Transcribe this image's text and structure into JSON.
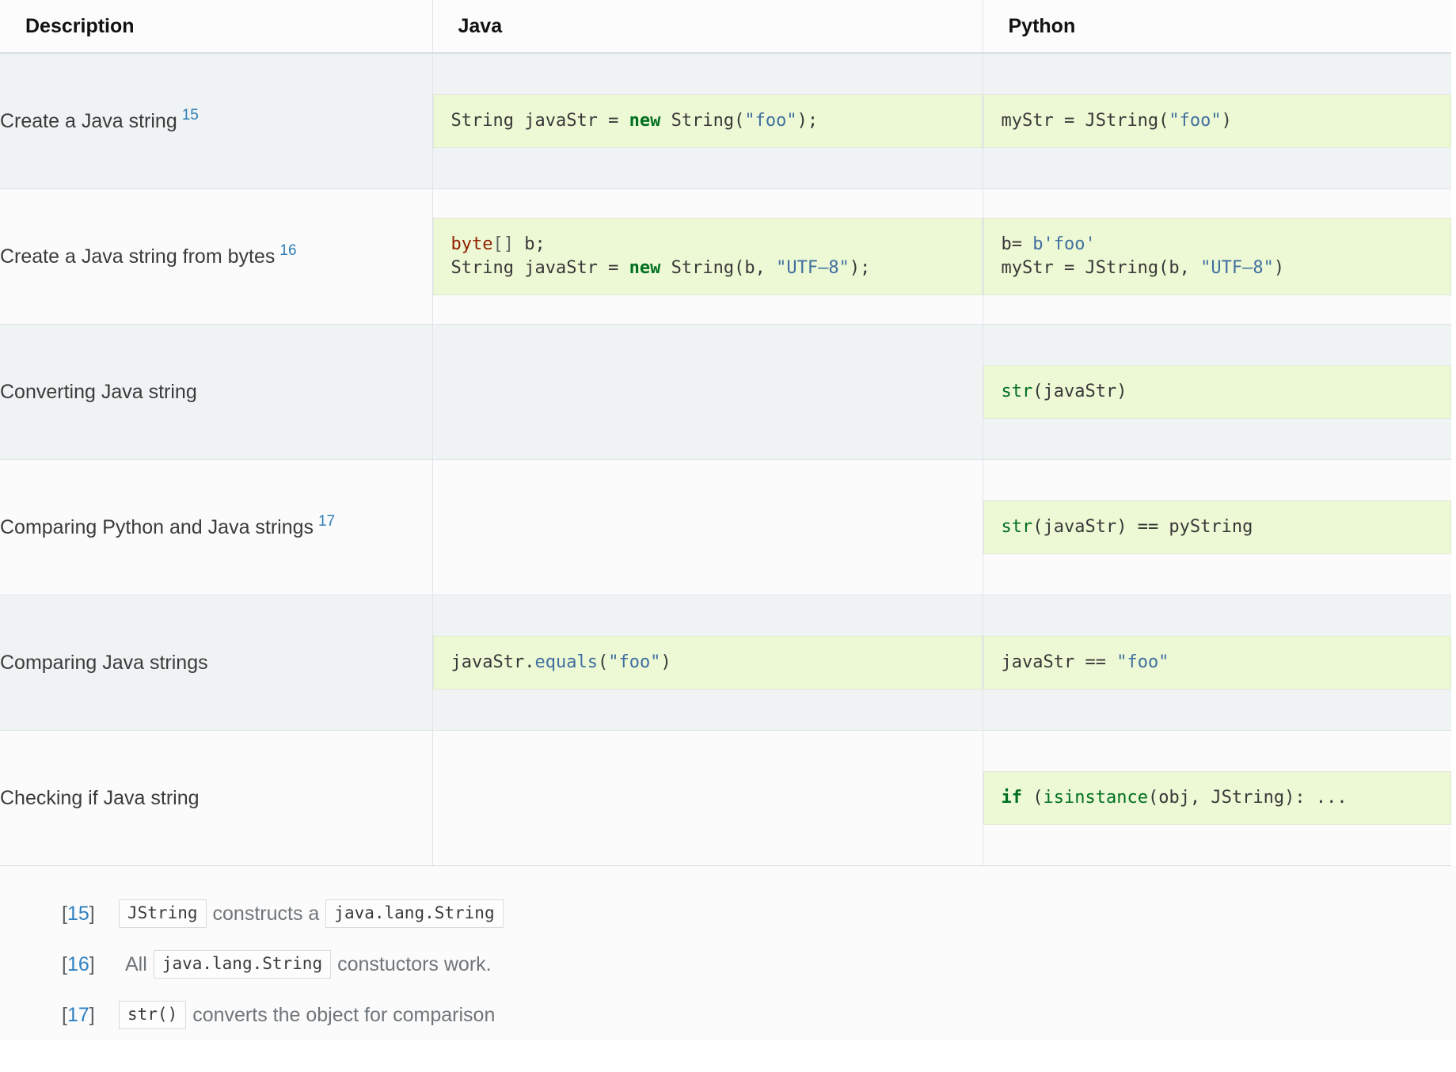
{
  "table": {
    "columns": [
      "Description",
      "Java",
      "Python"
    ],
    "rows": [
      {
        "description": "Create a Java string",
        "footnote_ref": "15",
        "java": [
          [
            {
              "t": "String javaStr = ",
              "c": "o"
            },
            {
              "t": "new",
              "c": "k"
            },
            {
              "t": " String(",
              "c": "o"
            },
            {
              "t": "\"foo\"",
              "c": "s"
            },
            {
              "t": ");",
              "c": "o"
            }
          ]
        ],
        "python": [
          [
            {
              "t": "myStr = JString(",
              "c": "o"
            },
            {
              "t": "\"foo\"",
              "c": "s"
            },
            {
              "t": ")",
              "c": "o"
            }
          ]
        ]
      },
      {
        "description": "Create a Java string from bytes",
        "footnote_ref": "16",
        "java": [
          [
            {
              "t": "byte",
              "c": "kt"
            },
            {
              "t": "[]",
              "c": "p"
            },
            {
              "t": " b;",
              "c": "o"
            }
          ],
          [
            {
              "t": "String javaStr = ",
              "c": "o"
            },
            {
              "t": "new",
              "c": "k"
            },
            {
              "t": " String(b, ",
              "c": "o"
            },
            {
              "t": "\"UTF–8\"",
              "c": "s"
            },
            {
              "t": ");",
              "c": "o"
            }
          ]
        ],
        "python": [
          [
            {
              "t": "b= ",
              "c": "o"
            },
            {
              "t": "b'foo'",
              "c": "s"
            }
          ],
          [
            {
              "t": "myStr = JString(b, ",
              "c": "o"
            },
            {
              "t": "\"UTF–8\"",
              "c": "s"
            },
            {
              "t": ")",
              "c": "o"
            }
          ]
        ]
      },
      {
        "description": "Converting Java string",
        "footnote_ref": "",
        "java": [],
        "python": [
          [
            {
              "t": "str",
              "c": "nb"
            },
            {
              "t": "(javaStr)",
              "c": "o"
            }
          ]
        ]
      },
      {
        "description": "Comparing Python and Java strings",
        "footnote_ref": "17",
        "java": [],
        "python": [
          [
            {
              "t": "str",
              "c": "nb"
            },
            {
              "t": "(javaStr) == pyString",
              "c": "o"
            }
          ]
        ]
      },
      {
        "description": "Comparing Java strings",
        "footnote_ref": "",
        "java": [
          [
            {
              "t": "javaStr.",
              "c": "o"
            },
            {
              "t": "equals",
              "c": "nf"
            },
            {
              "t": "(",
              "c": "o"
            },
            {
              "t": "\"foo\"",
              "c": "s"
            },
            {
              "t": ")",
              "c": "o"
            }
          ]
        ],
        "python": [
          [
            {
              "t": "javaStr == ",
              "c": "o"
            },
            {
              "t": "\"foo\"",
              "c": "s"
            }
          ]
        ]
      },
      {
        "description": "Checking if Java string",
        "footnote_ref": "",
        "java": [],
        "python": [
          [
            {
              "t": "if",
              "c": "k"
            },
            {
              "t": " (",
              "c": "o"
            },
            {
              "t": "isinstance",
              "c": "nb"
            },
            {
              "t": "(obj, JString): ...",
              "c": "o"
            }
          ]
        ]
      }
    ]
  },
  "footnotes": [
    {
      "label": "[15]",
      "open": "[",
      "number": "15",
      "close": "]",
      "parts": [
        {
          "kind": "code",
          "text": "JString"
        },
        {
          "kind": "text",
          "text": "constructs a"
        },
        {
          "kind": "code",
          "text": "java.lang.String"
        }
      ]
    },
    {
      "label": "[16]",
      "open": "[",
      "number": "16",
      "close": "]",
      "parts": [
        {
          "kind": "text",
          "text": "All"
        },
        {
          "kind": "code",
          "text": "java.lang.String"
        },
        {
          "kind": "text",
          "text": "constuctors work."
        }
      ]
    },
    {
      "label": "[17]",
      "open": "[",
      "number": "17",
      "close": "]",
      "parts": [
        {
          "kind": "code",
          "text": "str()"
        },
        {
          "kind": "text",
          "text": "converts the object for comparison"
        }
      ]
    }
  ],
  "colors": {
    "row_alt_background": "#eff3f4",
    "row_background": "#fbfbfb",
    "code_background": "#edf8d4",
    "link_blue": "#2e7db3",
    "keyword_green": "#007020",
    "type_red": "#902000",
    "string_blue": "#4070a0"
  }
}
